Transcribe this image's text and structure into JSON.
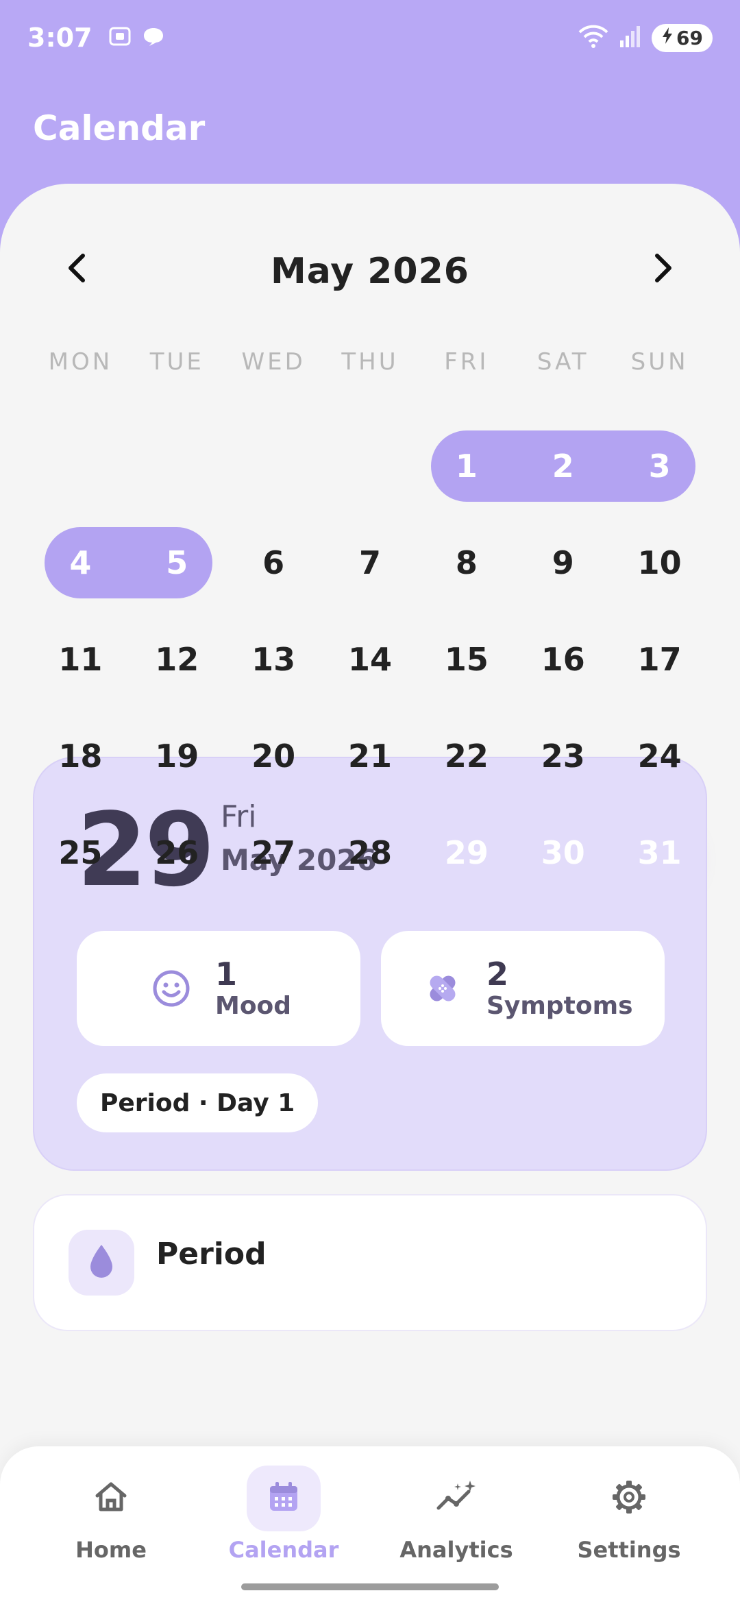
{
  "status_bar": {
    "time": "3:07",
    "battery": "69",
    "icons": [
      "screenshot-icon",
      "chat-bubble-icon",
      "wifi-icon",
      "signal-icon",
      "battery-icon"
    ]
  },
  "app": {
    "title": "Calendar"
  },
  "calendar": {
    "month_label": "May 2026",
    "weekdays": [
      "MON",
      "TUE",
      "WED",
      "THU",
      "FRI",
      "SAT",
      "SUN"
    ],
    "weeks": [
      [
        "",
        "",
        "",
        "",
        "1",
        "2",
        "3"
      ],
      [
        "4",
        "5",
        "6",
        "7",
        "8",
        "9",
        "10"
      ],
      [
        "11",
        "12",
        "13",
        "14",
        "15",
        "16",
        "17"
      ],
      [
        "18",
        "19",
        "20",
        "21",
        "22",
        "23",
        "24"
      ],
      [
        "25",
        "26",
        "27",
        "28",
        "29",
        "30",
        "31"
      ]
    ],
    "period_days": [
      "1",
      "2",
      "3",
      "4",
      "5",
      "29",
      "30",
      "31"
    ],
    "selected_day": "29"
  },
  "detail": {
    "day": "29",
    "weekday": "Fri",
    "month_year": "May 2026",
    "mood_count": "1",
    "mood_label": "Mood",
    "symptoms_count": "2",
    "symptoms_label": "Symptoms",
    "period_chip": "Period · Day 1"
  },
  "entry": {
    "label": "Period"
  },
  "bottom_nav": {
    "items": [
      {
        "label": "Home",
        "icon": "home-icon"
      },
      {
        "label": "Calendar",
        "icon": "calendar-icon",
        "active": true
      },
      {
        "label": "Analytics",
        "icon": "analytics-icon"
      },
      {
        "label": "Settings",
        "icon": "gear-icon"
      }
    ]
  },
  "colors": {
    "accent": "#b3a3f2",
    "header_bg": "#b8a8f5",
    "card_bg": "#e2dcfa",
    "text_dark": "#222222"
  }
}
